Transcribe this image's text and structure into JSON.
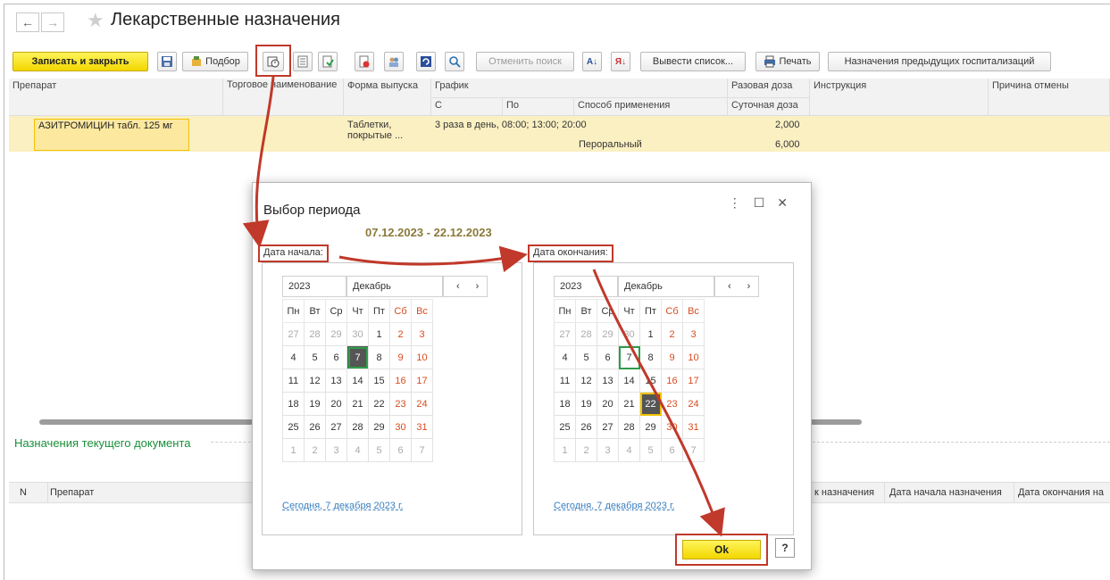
{
  "window": {
    "title": "Лекарственные назначения"
  },
  "nav": {
    "back": "←",
    "forward": "→"
  },
  "toolbar": {
    "save_close": "Записать и закрыть",
    "podbor": "Подбор",
    "cancel_search": "Отменить поиск",
    "output_list": "Вывести список...",
    "print": "Печать",
    "prev_prescriptions": "Назначения предыдущих госпитализаций"
  },
  "table": {
    "headers": {
      "drug": "Препарат",
      "trade_name": "Торговое наименование",
      "form": "Форма выпуска",
      "schedule": "График",
      "from": "С",
      "to": "По",
      "route": "Способ применения",
      "single_dose": "Разовая доза",
      "daily_dose": "Суточная доза",
      "instruction": "Инструкция",
      "cancel_reason": "Причина отмены"
    },
    "row": {
      "drug": "АЗИТРОМИЦИН табл. 125 мг",
      "form_line1": "Таблетки,",
      "form_line2": "покрытые ...",
      "schedule": "3 раза в день, 08:00; 13:00; 20:00",
      "route": "Пероральный",
      "single_dose": "2,000",
      "daily_dose": "6,000"
    }
  },
  "current_doc": {
    "title": "Назначения текущего документа",
    "col_n": "N",
    "col_drug": "Препарат",
    "col_sign": "к назначения",
    "col_start": "Дата начала назначения",
    "col_end": "Дата окончания на"
  },
  "dialog": {
    "title": "Выбор периода",
    "period": "07.12.2023 - 22.12.2023",
    "start_label": "Дата начала:",
    "end_label": "Дата окончания:",
    "year": "2023",
    "month": "Декабрь",
    "weekdays": [
      "Пн",
      "Вт",
      "Ср",
      "Чт",
      "Пт",
      "Сб",
      "Вс"
    ],
    "weeks": [
      [
        "27",
        "28",
        "29",
        "30",
        "1",
        "2",
        "3"
      ],
      [
        "4",
        "5",
        "6",
        "7",
        "8",
        "9",
        "10"
      ],
      [
        "11",
        "12",
        "13",
        "14",
        "15",
        "16",
        "17"
      ],
      [
        "18",
        "19",
        "20",
        "21",
        "22",
        "23",
        "24"
      ],
      [
        "25",
        "26",
        "27",
        "28",
        "29",
        "30",
        "31"
      ],
      [
        "1",
        "2",
        "3",
        "4",
        "5",
        "6",
        "7"
      ]
    ],
    "today": "Сегодня, 7 декабря 2023 г.",
    "ok": "Ok",
    "help": "?",
    "menu_icon": "⋮",
    "max_icon": "☐",
    "close_icon": "✕"
  },
  "colors": {
    "accent_yellow": "#f2d700",
    "highlight_red": "#c0392b",
    "weekend": "#d94b1e",
    "green": "#2e9e4a"
  }
}
